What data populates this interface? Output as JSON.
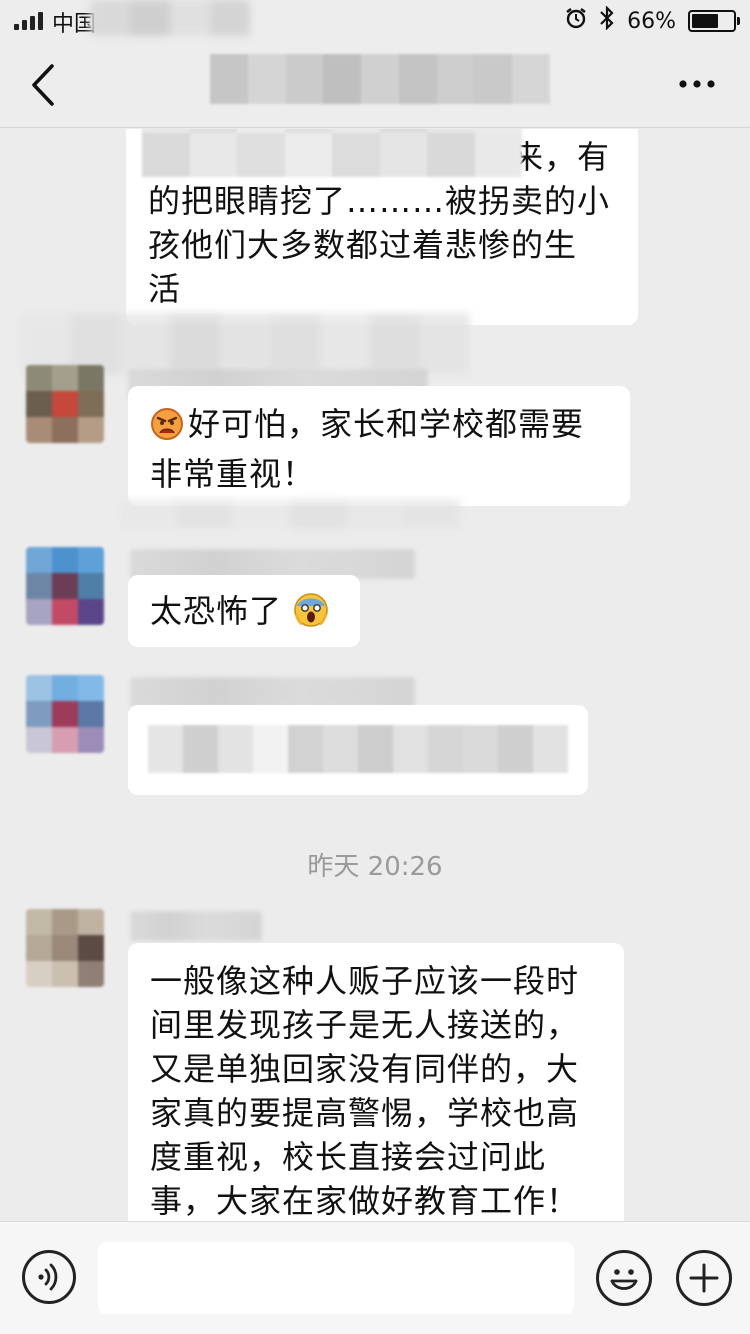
{
  "status_bar": {
    "carrier": "中国",
    "battery": "66%",
    "battery_level": 0.66,
    "icons": [
      "signal-icon",
      "alarm-icon",
      "bluetooth-icon",
      "battery-icon"
    ]
  },
  "nav": {
    "back_icon": "chevron-left-icon",
    "more_icon": "ellipsis-icon"
  },
  "messages": [
    {
      "lines": [
        "",
        "的把眼睛挖了………被拐卖的小",
        "孩他们大多数都过着悲惨的生",
        "活"
      ],
      "partial_line": "来，有"
    },
    {
      "emoji": "angry-face-icon",
      "lines": [
        "好可怕，家长和学校都需要",
        "非常重视！"
      ]
    },
    {
      "emoji": "screaming-face-icon",
      "text": "太恐怖了"
    },
    {
      "blurred": true
    },
    {
      "lines": [
        "一般像这种人贩子应该一段时",
        "间里发现孩子是无人接送的，",
        "又是单独回家没有同伴的，大",
        "家真的要提高警惕，学校也高",
        "度重视，校长直接会过问此",
        "事，大家在家做好教育工作！"
      ]
    }
  ],
  "timestamp": "昨天 20:26",
  "input_bar": {
    "voice_icon": "voice-icon",
    "emoji_icon": "smiley-icon",
    "plus_icon": "plus-icon",
    "placeholder": ""
  }
}
